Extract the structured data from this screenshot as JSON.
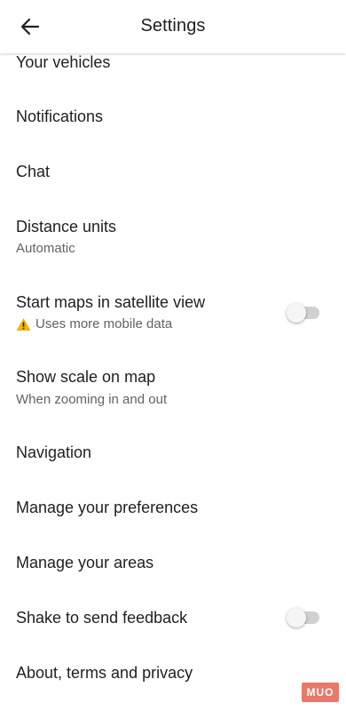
{
  "header": {
    "title": "Settings",
    "back_icon": "arrow-left-icon"
  },
  "settings": {
    "your_vehicles": {
      "title": "Your vehicles"
    },
    "notifications": {
      "title": "Notifications"
    },
    "chat": {
      "title": "Chat"
    },
    "distance_units": {
      "title": "Distance units",
      "subtitle": "Automatic"
    },
    "satellite_view": {
      "title": "Start maps in satellite view",
      "subtitle": "Uses more mobile data",
      "subtitle_icon": "warning-icon",
      "toggle_on": false
    },
    "show_scale": {
      "title": "Show scale on map",
      "subtitle": "When zooming in and out"
    },
    "navigation": {
      "title": "Navigation"
    },
    "manage_preferences": {
      "title": "Manage your preferences"
    },
    "manage_areas": {
      "title": "Manage your areas"
    },
    "shake_feedback": {
      "title": "Shake to send feedback",
      "toggle_on": false
    },
    "about": {
      "title": "About, terms and privacy"
    }
  },
  "watermark": {
    "text": "MUO"
  },
  "colors": {
    "primary_text": "#1f1f1f",
    "secondary_text": "#5f6368",
    "toggle_off_track": "#d0d0d0",
    "warning": "#f4b400",
    "watermark": "#e8796b"
  }
}
